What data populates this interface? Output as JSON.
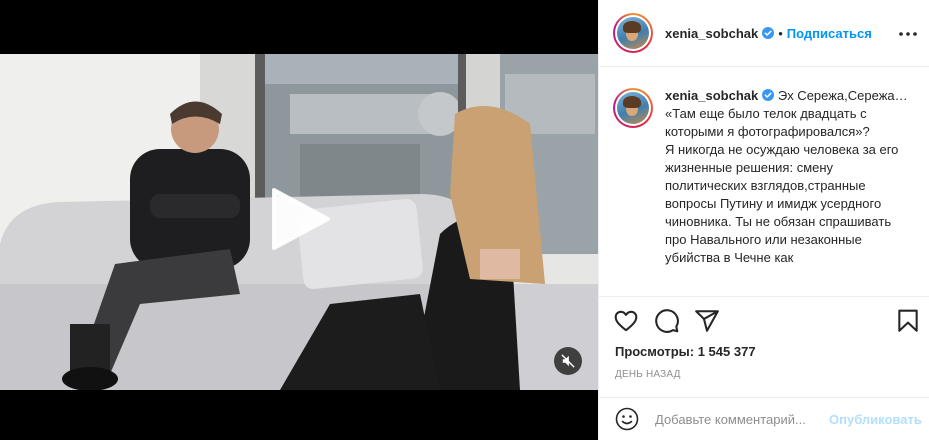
{
  "post": {
    "username": "xenia_sobchak",
    "follow_label": "Подписаться",
    "dot": "•",
    "caption": "Эх Сережа,Сережа… «Там еще было телок двадцать с которыми я фотографировался»?\nЯ никогда не осуждаю человека за его жизненные решения: смену политических взглядов,странные вопросы Путину и имидж усердного чиновника. Ты не обязан спрашивать про Навального или незаконные убийства в Чечне как",
    "views_label": "Просмотры:",
    "views_count": "1 545 377",
    "date": "день назад"
  },
  "comment": {
    "placeholder": "Добавьте комментарий...",
    "post_label": "Опубликовать"
  },
  "icons": {
    "verified": "verified-badge-icon",
    "more": "more-options-icon",
    "like": "heart-icon",
    "comment": "comment-icon",
    "share": "share-icon",
    "save": "bookmark-icon",
    "emoji": "emoji-icon",
    "play": "play-icon",
    "mute": "muted-speaker-icon"
  },
  "colors": {
    "link_blue": "#0095f6",
    "post_disabled": "#b2dffc",
    "muted_text": "#8e8e8e",
    "border": "#efefef"
  }
}
